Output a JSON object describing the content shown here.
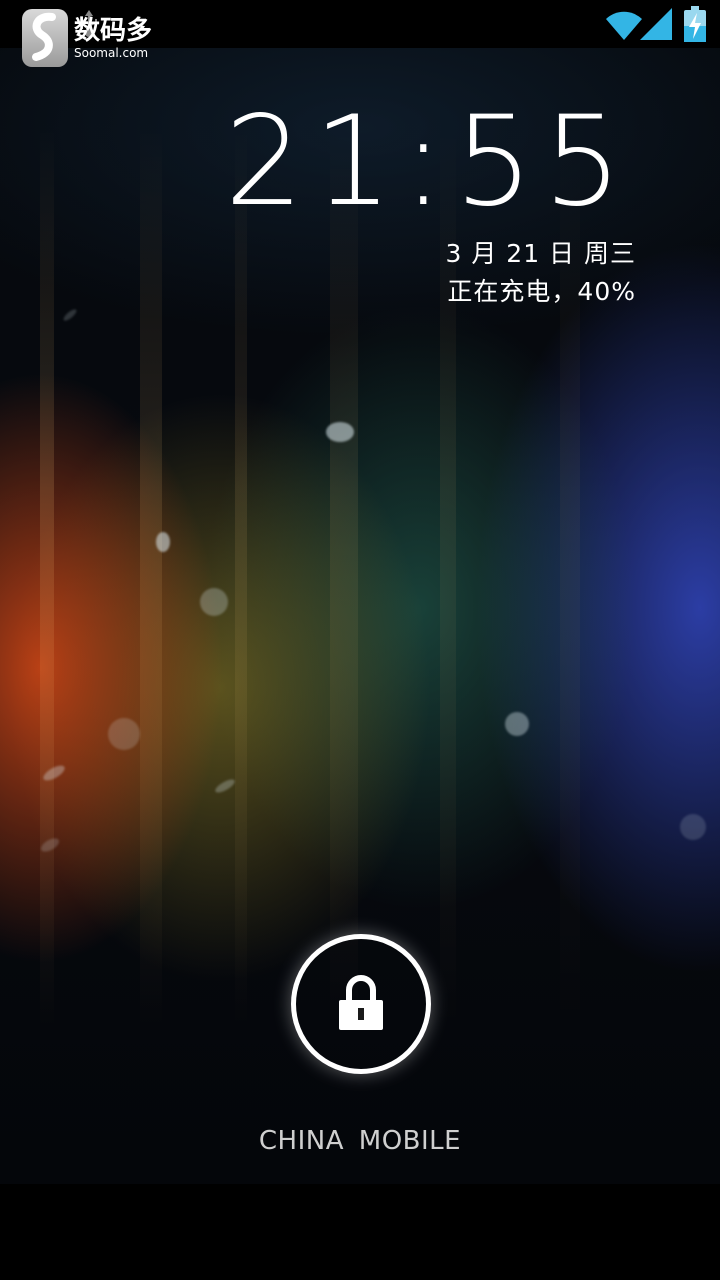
{
  "watermark": {
    "brand_cn": "数码多",
    "brand_en": "Soomal.com"
  },
  "status_bar": {
    "icons": [
      "android-debug-icon",
      "usb-icon",
      "wifi-icon",
      "signal-icon",
      "battery-charging-icon"
    ],
    "battery_level": 0.4
  },
  "lockscreen": {
    "time": "21:55",
    "date": "3 月 21 日 周三",
    "charging_status": "正在充电，40%",
    "carrier": "CHINA  MOBILE",
    "lock_icon": "lock-icon"
  },
  "colors": {
    "text": "#ffffff",
    "carrier_text": "#cfcfcf",
    "status_icon": "#33b5e5"
  }
}
